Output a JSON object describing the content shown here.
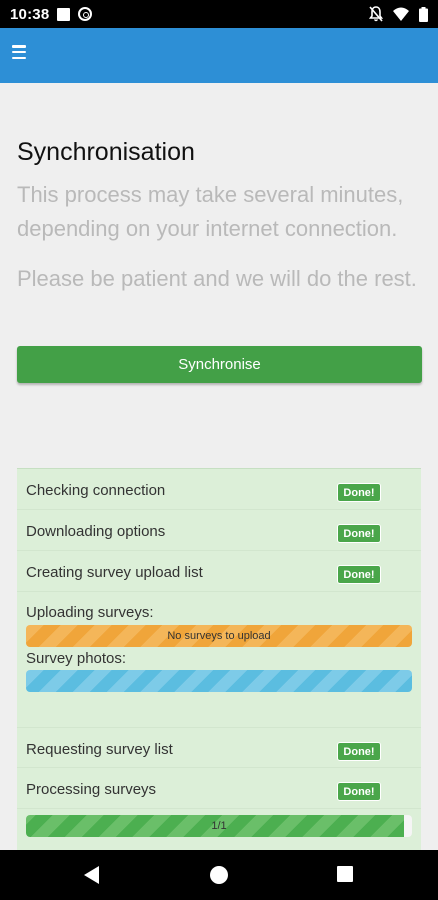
{
  "status_bar": {
    "time": "10:38",
    "icons": [
      "notification-square-icon",
      "sync-circle-icon",
      "mute-icon",
      "wifi-icon",
      "battery-icon"
    ]
  },
  "app_bar": {
    "color": "#2d8fd6",
    "menu_icon": "hamburger-menu-icon"
  },
  "main": {
    "title": "Synchronisation",
    "paragraph1": "This process may take several minutes, depending on your internet connection.",
    "paragraph2": "Please be patient and we will do the rest.",
    "sync_button": "Synchronise",
    "button_color": "#43a047"
  },
  "progress": {
    "steps": [
      {
        "label": "Checking connection",
        "status": "Done!"
      },
      {
        "label": "Downloading options",
        "status": "Done!"
      },
      {
        "label": "Creating survey upload list",
        "status": "Done!"
      }
    ],
    "uploading_label": "Uploading surveys:",
    "uploading_bar_text": "No surveys to upload",
    "uploading_progress": 1.0,
    "photos_label": "Survey photos:",
    "photos_progress": 1.0,
    "steps2": [
      {
        "label": "Requesting survey list",
        "status": "Done!"
      },
      {
        "label": "Processing surveys",
        "status": "Done!"
      }
    ],
    "final_bar_text": "1/1",
    "final_progress": 0.98
  },
  "nav_bar": {
    "back_icon": "back-triangle-icon",
    "home_icon": "home-circle-icon",
    "recents_icon": "recents-square-icon"
  }
}
